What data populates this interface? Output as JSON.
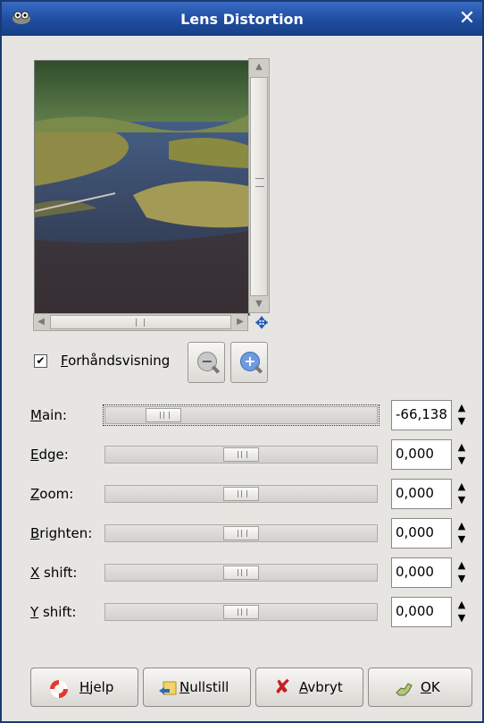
{
  "window": {
    "title": "Lens Distortion",
    "close_glyph": "✕"
  },
  "preview": {
    "checkbox_checked": true,
    "checkbox_label_mnemonic": "F",
    "checkbox_label_rest": "orhåndsvisning"
  },
  "params": [
    {
      "key": "main",
      "mnemonic": "M",
      "rest": "ain:",
      "value": "-66,138",
      "level": 0.17
    },
    {
      "key": "edge",
      "mnemonic": "E",
      "rest": "dge:",
      "value": "0,000",
      "level": 0.5
    },
    {
      "key": "zoom",
      "mnemonic": "Z",
      "rest": "oom:",
      "value": "0,000",
      "level": 0.5
    },
    {
      "key": "brighten",
      "mnemonic": "B",
      "rest": "righten:",
      "value": "0,000",
      "level": 0.5
    },
    {
      "key": "xshift",
      "mnemonic": "X",
      "rest": " shift:",
      "value": "0,000",
      "level": 0.5
    },
    {
      "key": "yshift",
      "mnemonic": "Y",
      "rest": " shift:",
      "value": "0,000",
      "level": 0.5
    }
  ],
  "buttons": {
    "help": {
      "mnemonic": "H",
      "rest": "jelp",
      "icon": "lifebuoy-icon"
    },
    "reset": {
      "mnemonic": "N",
      "rest": "ullstill",
      "icon": "reset-icon"
    },
    "cancel": {
      "mnemonic": "A",
      "rest": "vbryt",
      "icon": "cancel-x-icon"
    },
    "ok": {
      "mnemonic": "O",
      "rest": "K",
      "icon": "ok-hand-icon"
    }
  },
  "colors": {
    "titlebar": "#1e4d9f",
    "focus_dots": "#333333"
  }
}
